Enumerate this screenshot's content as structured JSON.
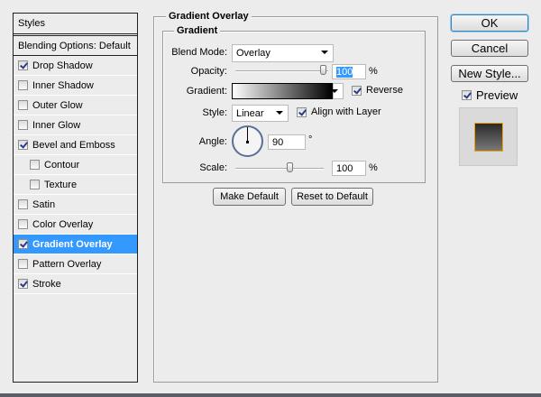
{
  "styles_list": {
    "header": "Styles",
    "blending": "Blending Options: Default",
    "items": [
      {
        "label": "Drop Shadow",
        "checked": true
      },
      {
        "label": "Inner Shadow",
        "checked": false
      },
      {
        "label": "Outer Glow",
        "checked": false
      },
      {
        "label": "Inner Glow",
        "checked": false
      },
      {
        "label": "Bevel and Emboss",
        "checked": true
      },
      {
        "label": "Contour",
        "checked": false,
        "sub": true
      },
      {
        "label": "Texture",
        "checked": false,
        "sub": true
      },
      {
        "label": "Satin",
        "checked": false
      },
      {
        "label": "Color Overlay",
        "checked": false
      },
      {
        "label": "Gradient Overlay",
        "checked": true,
        "selected": true
      },
      {
        "label": "Pattern Overlay",
        "checked": false
      },
      {
        "label": "Stroke",
        "checked": true
      }
    ]
  },
  "panel": {
    "title": "Gradient Overlay",
    "group": "Gradient",
    "blend_mode_label": "Blend Mode:",
    "blend_mode": "Overlay",
    "opacity_label": "Opacity:",
    "opacity": "100",
    "opacity_unit": "%",
    "gradient_label": "Gradient:",
    "reverse_label": "Reverse",
    "reverse": true,
    "style_label": "Style:",
    "style": "Linear",
    "align_label": "Align with Layer",
    "align": true,
    "angle_label": "Angle:",
    "angle": "90",
    "angle_unit": "°",
    "scale_label": "Scale:",
    "scale": "100",
    "scale_unit": "%",
    "make_default": "Make Default",
    "reset_default": "Reset to Default"
  },
  "actions": {
    "ok": "OK",
    "cancel": "Cancel",
    "new_style": "New Style...",
    "preview_label": "Preview",
    "preview": true
  },
  "colors": {
    "selection": "#3399ff",
    "preview_border": "#f5a300"
  }
}
